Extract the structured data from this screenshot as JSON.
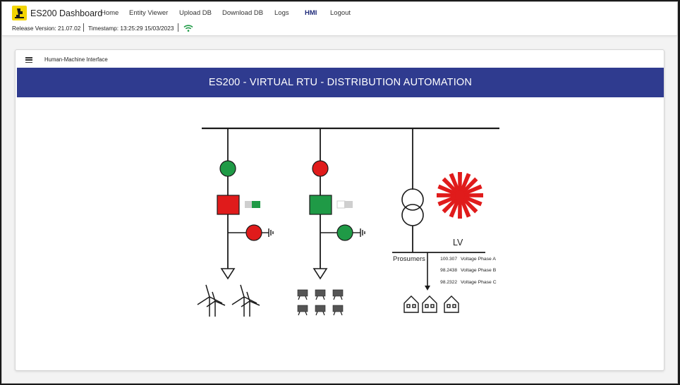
{
  "app": {
    "brand": "ES200 Dashboard"
  },
  "nav": {
    "items": [
      {
        "label": "Home"
      },
      {
        "label": "Entity Viewer"
      },
      {
        "label": "Upload DB"
      },
      {
        "label": "Download DB"
      },
      {
        "label": "Logs"
      },
      {
        "label": "HMI",
        "active": true
      },
      {
        "label": "Logout"
      }
    ]
  },
  "status": {
    "release": "Release Version: 21.07.02",
    "timestamp": "Timestamp: 13:25:29 15/03/2023",
    "connection_icon": "wifi-icon"
  },
  "card": {
    "title": "Human-Machine Interface",
    "banner": "ES200 - VIRTUAL RTU - DISTRIBUTION AUTOMATION"
  },
  "hmi": {
    "feeder_1": {
      "breaker_state": "closed",
      "indicator": "green",
      "earth_switch": "red",
      "toggle": "on",
      "load": "wind-turbines"
    },
    "feeder_2": {
      "breaker_state": "open",
      "indicator": "red",
      "earth_switch": "green",
      "toggle": "off",
      "load": "solar-panels"
    },
    "transformer": {
      "alarm": "red-starburst-icon"
    },
    "lv_label": "LV",
    "prosumers_label": "Prosumers",
    "voltages": [
      {
        "value": "100.307",
        "name": "Voltage Phase A"
      },
      {
        "value": "98.2438",
        "name": "Voltage Phase B"
      },
      {
        "value": "98.2322",
        "name": "Voltage Phase C"
      }
    ],
    "colors": {
      "green": "#1f9a46",
      "red": "#e01b1b",
      "banner": "#2f3b8f",
      "nav_active": "#1f2a7a"
    }
  }
}
